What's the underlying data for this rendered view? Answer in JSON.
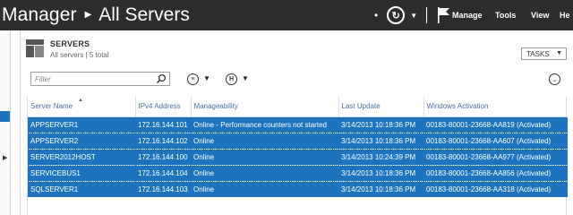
{
  "header": {
    "app_title": "Manager",
    "page_title": "All Servers",
    "menu": [
      "Manage",
      "Tools",
      "View",
      "He"
    ]
  },
  "section": {
    "title": "SERVERS",
    "subtitle": "All servers | 5 total",
    "tasks_label": "TASKS"
  },
  "filter": {
    "placeholder": "Filter"
  },
  "table": {
    "columns": [
      "Server Name",
      "IPv4 Address",
      "Manageability",
      "Last Update",
      "Windows Activation"
    ],
    "rows": [
      [
        "APPSERVER1",
        "172.16.144.101",
        "Online - Performance counters not started",
        "3/14/2013 10:18:36 PM",
        "00183-80001-23668-AA819 (Activated)"
      ],
      [
        "APPSERVER2",
        "172.16.144.102",
        "Online",
        "3/14/2013 10:18:36 PM",
        "00183-80001-23668-AA607 (Activated)"
      ],
      [
        "SERVER2012HOST",
        "172.16.144.100",
        "Online",
        "3/14/2013 10:24:39 PM",
        "00183-80001-23668-AA977 (Activated)"
      ],
      [
        "SERVICEBUS1",
        "172.16.144.104",
        "Online",
        "3/14/2013 10:18:36 PM",
        "00183-80001-23668-AA856 (Activated)"
      ],
      [
        "SQLSERVER1",
        "172.16.144.103",
        "Online",
        "3/14/2013 10:18:36 PM",
        "00183-80001-23668-AA318 (Activated)"
      ]
    ]
  },
  "colors": {
    "titlebar": "#2d2d30",
    "selection": "#1e73be",
    "header_text": "#4a6fa5"
  },
  "icons": [
    "back-icon",
    "refresh-icon",
    "flag-icon",
    "servers-icon",
    "search-icon",
    "list-icon",
    "save-icon",
    "chevron-down-icon"
  ]
}
